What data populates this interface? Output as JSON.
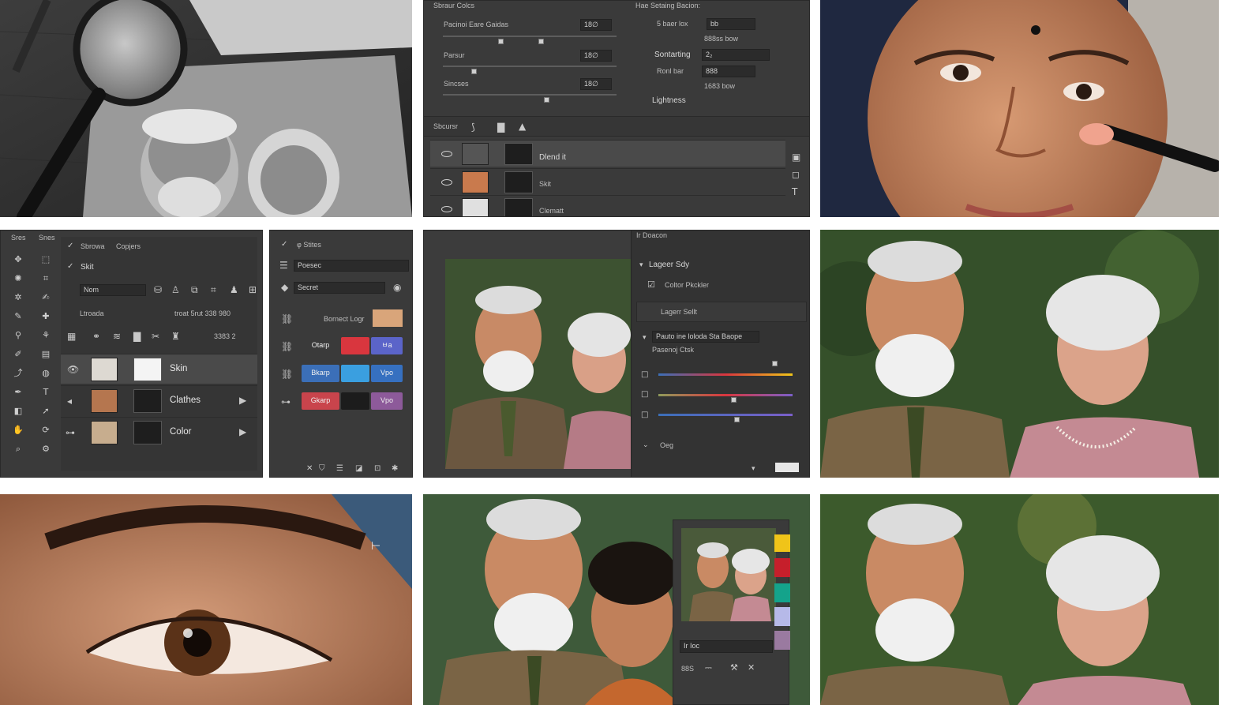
{
  "image_title": "",
  "colors": {
    "panel_bg": "#3a3a3a",
    "panel_dark": "#2b2b2b",
    "accent_red": "#d9363e",
    "accent_blue": "#3a8fd9",
    "accent_purple": "#7b5fc9",
    "swatch_yellow": "#f0c419",
    "swatch_red": "#c61f2b",
    "swatch_teal": "#14a38b",
    "swatch_lavender": "#b6b9e8",
    "swatch_mauve": "#9a7aa0"
  },
  "tile_2": {
    "header_left": "Sbraur Colcs",
    "header_right": "Hae Setaing Bacion:",
    "slider_1_label": "Pacinoi  Eare Gaidas",
    "slider_1_value": "18∅",
    "slider_2_label": "Parsur",
    "slider_2_value": "18∅",
    "slider_3_label": "Sincses",
    "slider_3_value": "18∅",
    "right_row_1_label": "5 baer lox",
    "right_row_1_value": "bb",
    "right_row_1_sub": "888ss bow",
    "right_row_2_label": "Sontarting",
    "right_row_2_value": "2₂",
    "right_row_3_label": "Ronl bar",
    "right_row_3_value": "888",
    "right_row_3_sub": "1683 bow",
    "lightness_label": "Lightness",
    "toolbar_label": "Sbcursr",
    "layers": [
      {
        "name": "Dlend it"
      },
      {
        "name": "Skit"
      },
      {
        "name": "Clematt"
      }
    ]
  },
  "tile_4": {
    "header_1": "Sbrowa",
    "header_2": "Copjers",
    "group_label": "Skit",
    "mode_label": "Nom",
    "lock_label": "Ltroada",
    "opacity_text": "troat 5rut  338  980",
    "fill_value": "3383 2",
    "tool_header_1": "Sres",
    "tool_header_2": "Snes",
    "layers": [
      {
        "name": "Skin"
      },
      {
        "name": "Clathes"
      },
      {
        "name": "Color"
      }
    ]
  },
  "tile_5": {
    "header": "φ Stites",
    "dropdown_1": "Poesec",
    "dropdown_2": "Secret",
    "row_1_label": "Bornect Logr",
    "row_2_btn_1": "Otarp",
    "row_2_btn_3": "ㅂa",
    "row_3_btn_1": "Bkarp",
    "row_3_btn_3": "Vpo",
    "row_4_btn_1": "Gkarp",
    "row_4_btn_3": "Vpo"
  },
  "tile_6": {
    "panel_title": "Ir Doacon",
    "layer_style": "Lageer Sdy",
    "color_picker": "Coltor  Pkckler",
    "layer_split": "Lagerr Sellt",
    "field_text": "Pauto ine loloda  Sta Baope",
    "sub_text": "Pasenoj Ctsk",
    "bottom_label": "Oeg"
  },
  "tile_11": {
    "field_label": "Ir Ioc",
    "bottom_value": "88S"
  }
}
